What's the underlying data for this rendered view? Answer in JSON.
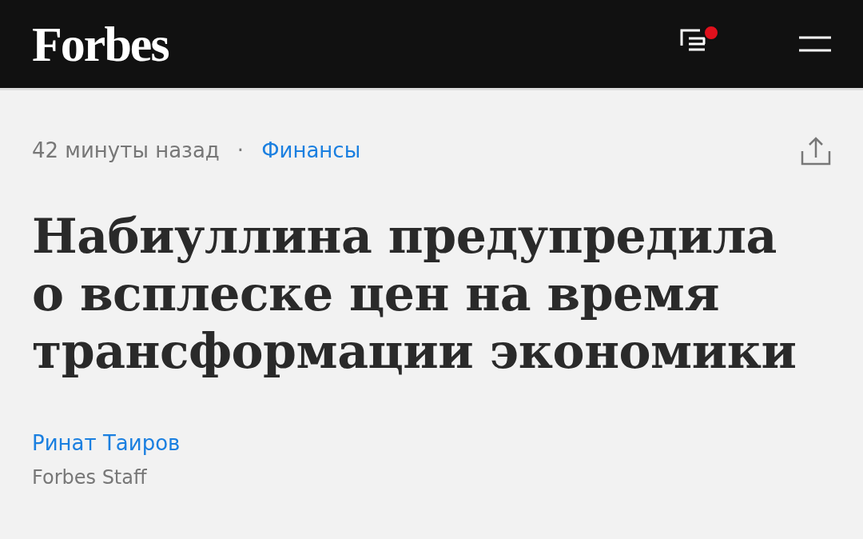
{
  "header": {
    "logo": "Forbes",
    "notifications": {
      "unread": true
    }
  },
  "article": {
    "time": "42 минуты назад",
    "separator": "·",
    "category": "Финансы",
    "title": "Набиуллина предупредила о всплеске цен на время трансформации экономики",
    "author": "Ринат Таиров",
    "author_role": "Forbes Staff"
  }
}
